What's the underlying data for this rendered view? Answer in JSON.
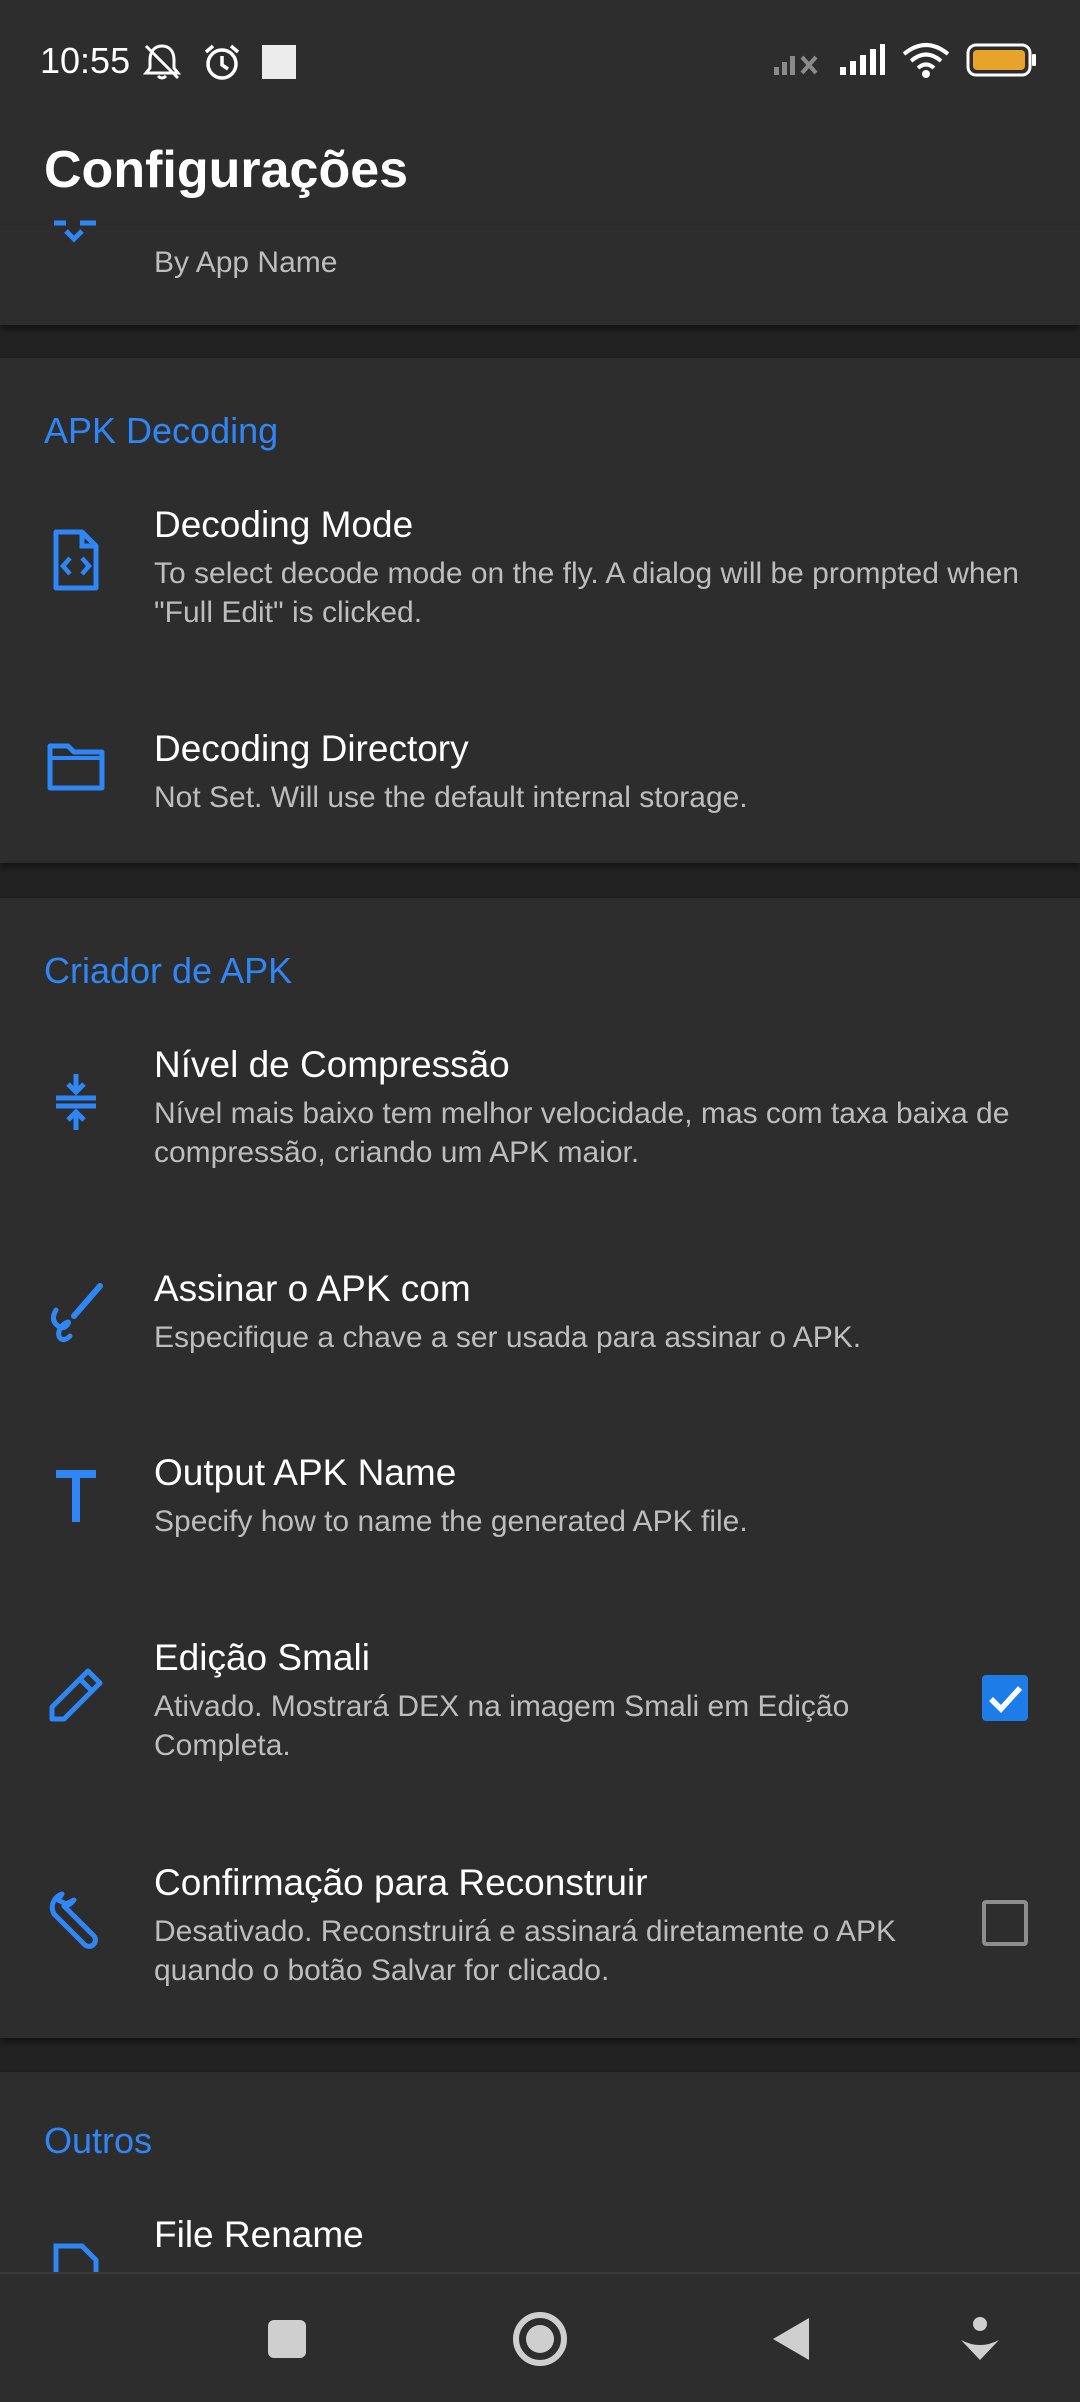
{
  "status_bar": {
    "time": "10:55",
    "left_icons": [
      "mute-icon",
      "alarm-icon",
      "square-icon"
    ],
    "right_icons": [
      "signal-off-icon",
      "signal-icon",
      "wifi-icon",
      "battery-icon"
    ],
    "battery_color": "#e8a42a"
  },
  "app_bar": {
    "title": "Configurações"
  },
  "partial_item": {
    "subtitle": "By App Name",
    "icon": "sort-icon"
  },
  "sections": {
    "decoding": {
      "title": "APK Decoding",
      "items": [
        {
          "title": "Decoding Mode",
          "subtitle": "To select decode mode on the fly. A dialog will be prompted when \"Full Edit\" is clicked.",
          "icon": "code-file-icon"
        },
        {
          "title": "Decoding Directory",
          "subtitle": "Not Set. Will use the default internal storage.",
          "icon": "folder-icon"
        }
      ]
    },
    "builder": {
      "title": "Criador de APK",
      "items": [
        {
          "title": "Nível de Compressão",
          "subtitle": "Nível mais baixo tem melhor velocidade, mas com taxa baixa de compressão, criando um APK maior.",
          "icon": "compress-icon"
        },
        {
          "title": "Assinar o APK com",
          "subtitle": "Especifique a chave a ser usada para assinar o APK.",
          "icon": "signature-icon"
        },
        {
          "title": "Output APK Name",
          "subtitle": "Specify how to name the generated APK file.",
          "icon": "text-icon"
        },
        {
          "title": "Edição Smali",
          "subtitle": "Ativado. Mostrará DEX na imagem Smali em Edição Completa.",
          "icon": "pencil-icon",
          "checked": true
        },
        {
          "title": "Confirmação para Reconstruir",
          "subtitle": "Desativado. Reconstruirá e assinará diretamente o APK quando o botão Salvar for clicado.",
          "icon": "wrench-icon",
          "checked": false
        }
      ]
    },
    "others": {
      "title": "Outros",
      "items": [
        {
          "title": "File Rename",
          "icon": "file-icon"
        }
      ]
    }
  },
  "nav_bar": {
    "buttons": [
      "recents-button",
      "home-button",
      "back-button",
      "assist-button"
    ]
  },
  "colors": {
    "accent": "#2f86f6",
    "background": "#222222",
    "surface": "#2d2d2d"
  }
}
